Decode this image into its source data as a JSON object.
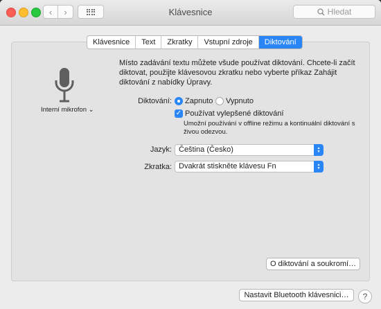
{
  "window": {
    "title": "Klávesnice"
  },
  "search": {
    "placeholder": "Hledat"
  },
  "tabs": [
    {
      "label": "Klávesnice",
      "active": false
    },
    {
      "label": "Text",
      "active": false
    },
    {
      "label": "Zkratky",
      "active": false
    },
    {
      "label": "Vstupní zdroje",
      "active": false
    },
    {
      "label": "Diktování",
      "active": true
    }
  ],
  "mic": {
    "label": "Interní mikrofon"
  },
  "description": "Místo zadávání textu můžete všude používat diktování. Chcete-li začít diktovat, použijte klávesovou zkratku nebo vyberte příkaz Zahájit diktování z nabídky Úpravy.",
  "dictation": {
    "label": "Diktování:",
    "on_label": "Zapnuto",
    "off_label": "Vypnuto",
    "selected": "Zapnuto",
    "enhanced_label": "Používat vylepšené diktování",
    "enhanced_checked": true,
    "enhanced_hint": "Umožní používání v offline režimu a kontinuální diktování s živou odezvou."
  },
  "language": {
    "label": "Jazyk:",
    "value": "Čeština (Česko)"
  },
  "shortcut": {
    "label": "Zkratka:",
    "value": "Dvakrát stiskněte klávesu Fn"
  },
  "buttons": {
    "privacy": "O diktování a soukromí…",
    "bluetooth": "Nastavit Bluetooth klávesnici…",
    "help": "?"
  },
  "colors": {
    "accent": "#2a86f7",
    "red": "#fd5f57",
    "yellow": "#febc2e",
    "green": "#28c840"
  }
}
